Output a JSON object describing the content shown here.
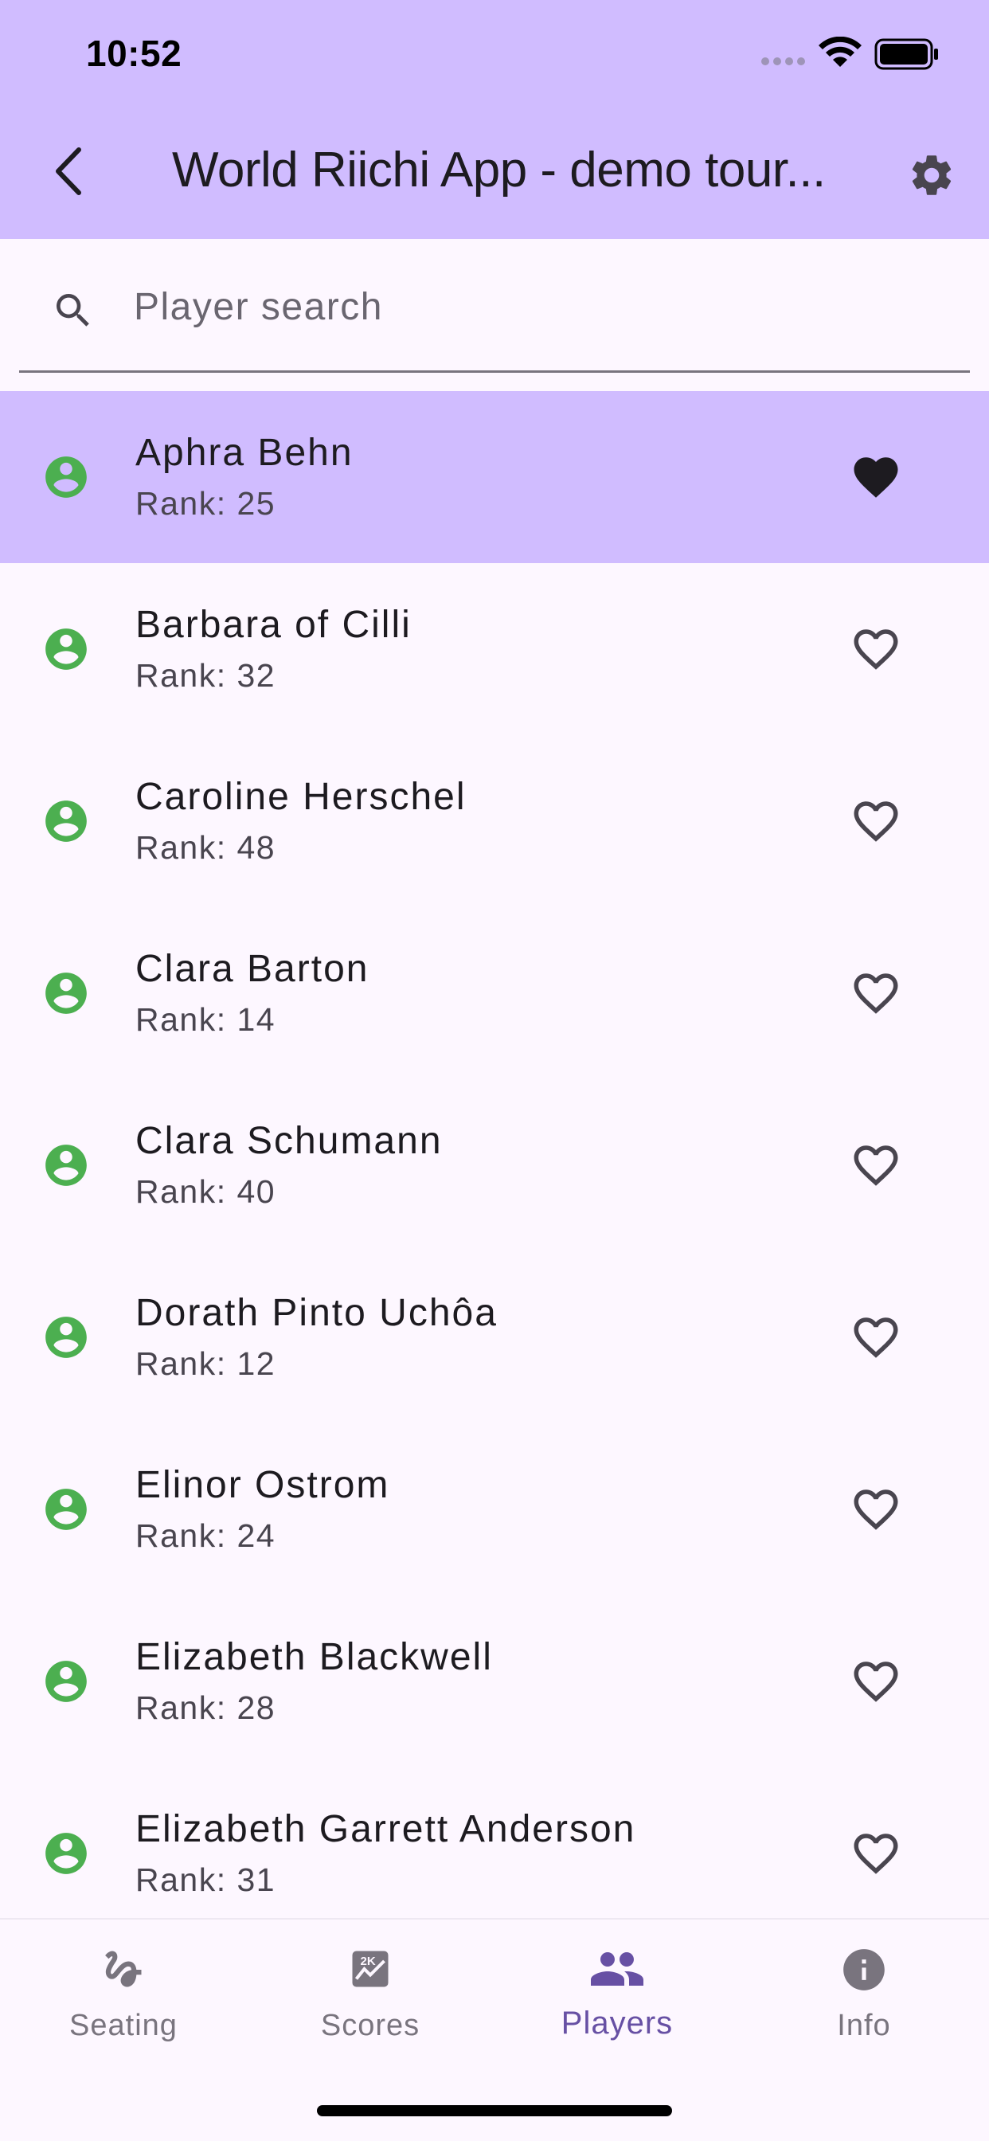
{
  "status_bar": {
    "time": "10:52"
  },
  "app_bar": {
    "title": "World Riichi App - demo tour..."
  },
  "search": {
    "placeholder": "Player search",
    "value": ""
  },
  "players": [
    {
      "name": "Aphra Behn",
      "rank": "Rank: 25",
      "favorite": true
    },
    {
      "name": "Barbara of Cilli",
      "rank": "Rank: 32",
      "favorite": false
    },
    {
      "name": "Caroline Herschel",
      "rank": "Rank: 48",
      "favorite": false
    },
    {
      "name": "Clara Barton",
      "rank": "Rank: 14",
      "favorite": false
    },
    {
      "name": "Clara Schumann",
      "rank": "Rank: 40",
      "favorite": false
    },
    {
      "name": "Dorath Pinto Uchôa",
      "rank": "Rank: 12",
      "favorite": false
    },
    {
      "name": "Elinor Ostrom",
      "rank": "Rank: 24",
      "favorite": false
    },
    {
      "name": "Elizabeth Blackwell",
      "rank": "Rank: 28",
      "favorite": false
    },
    {
      "name": "Elizabeth Garrett Anderson",
      "rank": "Rank: 31",
      "favorite": false
    }
  ],
  "bottom_nav": {
    "items": [
      {
        "label": "Seating",
        "icon": "seat-icon",
        "active": false
      },
      {
        "label": "Scores",
        "icon": "scores-icon",
        "active": false
      },
      {
        "label": "Players",
        "icon": "people-icon",
        "active": true
      },
      {
        "label": "Info",
        "icon": "info-icon",
        "active": false
      }
    ]
  },
  "colors": {
    "app_bar": "#d0bcff",
    "selected_row": "#d0bcff",
    "avatar": "#4caf50",
    "active_nav": "#6750a4",
    "inactive_nav": "#79747e"
  }
}
